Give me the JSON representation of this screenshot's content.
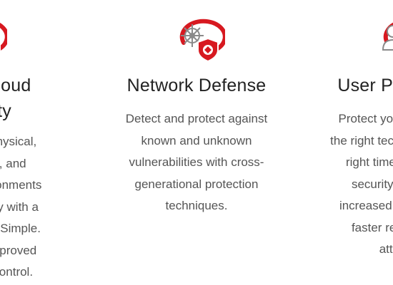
{
  "features": [
    {
      "title_line1": "Hybrid Cloud",
      "title_line2": "Security",
      "description_lines": [
        "Secure your physical,",
        "virtual, cloud, and",
        "container environments",
        "more effectively with a",
        "single solution. Simple.",
        "Automated. Improved",
        "visibility and control."
      ],
      "icon": "server-shield-icon"
    },
    {
      "title_line1": "Network Defense",
      "description_lines": [
        "Detect and protect against",
        "known and unknown",
        "vulnerabilities with cross-",
        "generational protection",
        "techniques."
      ],
      "icon": "network-shield-icon"
    },
    {
      "title_line1": "User Protection",
      "description_lines": [
        "Protect your users with",
        "the right techniques at the",
        "right time with smart",
        "security that gives",
        "increased visibility and",
        "faster response to",
        "attacks."
      ],
      "icon": "user-shield-icon"
    }
  ],
  "colors": {
    "accent_red": "#d71920",
    "icon_gray": "#8a8a8a",
    "title": "#222222",
    "body": "#555555"
  }
}
